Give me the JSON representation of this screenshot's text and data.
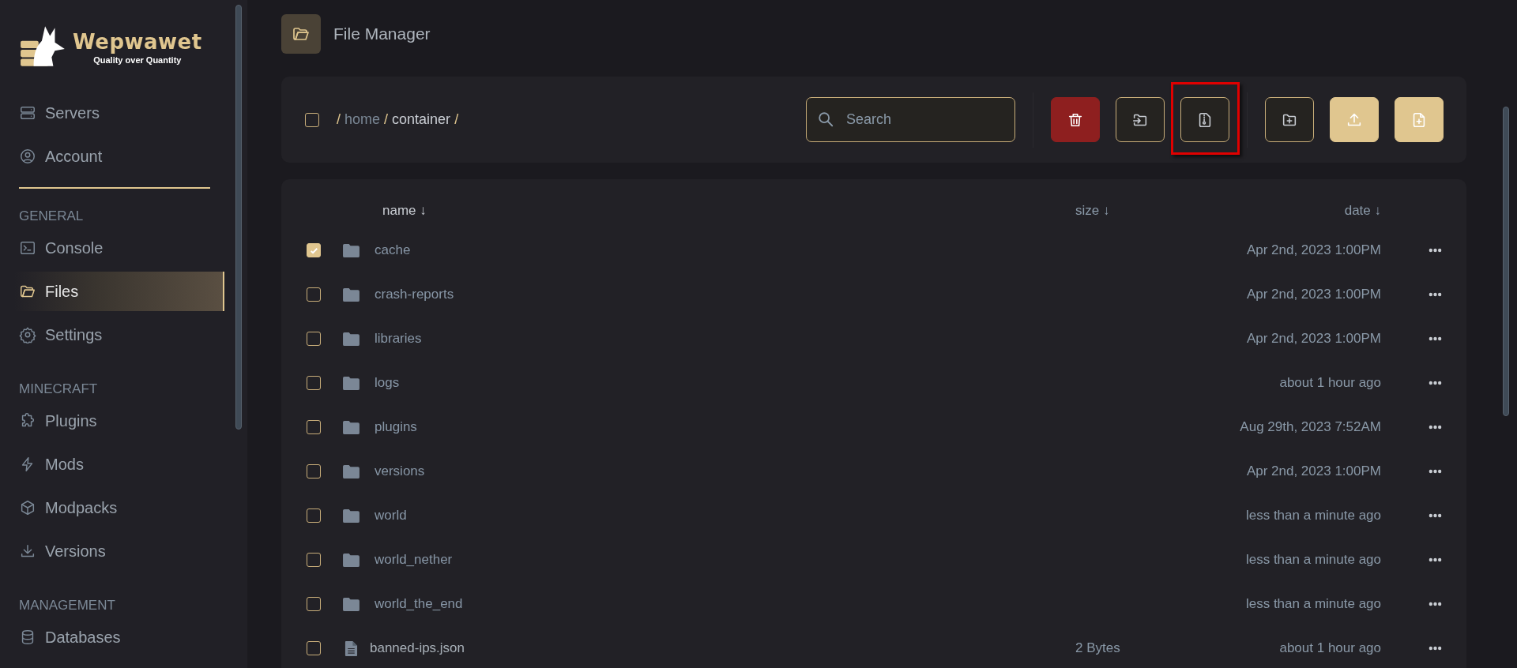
{
  "brand": {
    "name": "Wepwawet",
    "tagline": "Quality over Quantity"
  },
  "sidebar": {
    "sections": [
      {
        "items": [
          {
            "label": "Servers",
            "kind": "servers",
            "selected": false
          },
          {
            "label": "Account",
            "kind": "account",
            "selected": false
          }
        ]
      },
      {
        "heading": "GENERAL",
        "items": [
          {
            "label": "Console",
            "kind": "console",
            "selected": false
          },
          {
            "label": "Files",
            "kind": "files",
            "selected": true
          },
          {
            "label": "Settings",
            "kind": "settings",
            "selected": false
          }
        ]
      },
      {
        "heading": "MINECRAFT",
        "items": [
          {
            "label": "Plugins",
            "kind": "plugins",
            "selected": false
          },
          {
            "label": "Mods",
            "kind": "mods",
            "selected": false
          },
          {
            "label": "Modpacks",
            "kind": "modpacks",
            "selected": false
          },
          {
            "label": "Versions",
            "kind": "versions",
            "selected": false
          }
        ]
      },
      {
        "heading": "MANAGEMENT",
        "items": [
          {
            "label": "Databases",
            "kind": "databases",
            "selected": false
          }
        ]
      }
    ]
  },
  "page": {
    "title": "File Manager"
  },
  "toolbar": {
    "select_all": {
      "checked": false
    },
    "path_root": "/",
    "breadcrumb": [
      {
        "label": "home",
        "current": false,
        "separator": "/"
      },
      {
        "label": "container",
        "current": true,
        "separator": "/"
      }
    ],
    "search": {
      "placeholder": "Search"
    },
    "button_groups": [
      [
        {
          "kind": "delete",
          "highlighted": false
        },
        {
          "kind": "move",
          "highlighted": false
        },
        {
          "kind": "archive",
          "highlighted": true
        }
      ],
      [
        {
          "kind": "new-folder",
          "highlighted": false
        },
        {
          "kind": "upload",
          "highlighted": false
        },
        {
          "kind": "new-file",
          "highlighted": false
        }
      ]
    ]
  },
  "table": {
    "columns": [
      {
        "label": "name",
        "arrow": "↓"
      },
      {
        "label": "size",
        "arrow": "↓"
      },
      {
        "label": "date",
        "arrow": "↓"
      }
    ],
    "rows": [
      {
        "kind": "folder",
        "name": "cache",
        "date": "Apr 2nd, 2023 1:00PM",
        "selected": true
      },
      {
        "kind": "folder",
        "name": "crash-reports",
        "date": "Apr 2nd, 2023 1:00PM",
        "selected": false
      },
      {
        "kind": "folder",
        "name": "libraries",
        "date": "Apr 2nd, 2023 1:00PM",
        "selected": false
      },
      {
        "kind": "folder",
        "name": "logs",
        "date": "about 1 hour ago",
        "selected": false
      },
      {
        "kind": "folder",
        "name": "plugins",
        "date": "Aug 29th, 2023 7:52AM",
        "selected": false
      },
      {
        "kind": "folder",
        "name": "versions",
        "date": "Apr 2nd, 2023 1:00PM",
        "selected": false
      },
      {
        "kind": "folder",
        "name": "world",
        "date": "less than a minute ago",
        "selected": false
      },
      {
        "kind": "folder",
        "name": "world_nether",
        "date": "less than a minute ago",
        "selected": false
      },
      {
        "kind": "folder",
        "name": "world_the_end",
        "date": "less than a minute ago",
        "selected": false
      },
      {
        "kind": "file",
        "name": "banned-ips.json",
        "size": "2 Bytes",
        "date": "about 1 hour ago",
        "selected": false
      }
    ]
  }
}
